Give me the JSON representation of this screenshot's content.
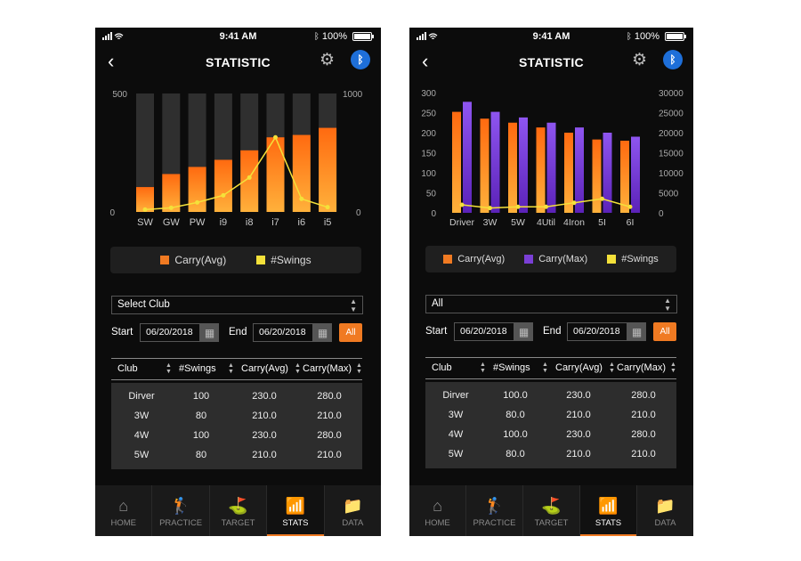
{
  "phones": [
    {
      "status": {
        "time": "9:41 AM",
        "battery": "100%"
      },
      "header": {
        "title": "STATISTIC"
      },
      "legend": [
        "Carry(Avg)",
        "#Swings"
      ],
      "select_label": "Select Club",
      "dates": {
        "start_label": "Start",
        "start": "06/20/2018",
        "end_label": "End",
        "end": "06/20/2018",
        "all": "All"
      },
      "table": {
        "headers": [
          "Club",
          "#Swings",
          "Carry(Avg)",
          "Carry(Max)"
        ],
        "rows": [
          [
            "Dirver",
            "100",
            "230.0",
            "280.0"
          ],
          [
            "3W",
            "80",
            "210.0",
            "210.0"
          ],
          [
            "4W",
            "100",
            "230.0",
            "280.0"
          ],
          [
            "5W",
            "80",
            "210.0",
            "210.0"
          ]
        ]
      },
      "tabs": [
        "HOME",
        "PRACTICE",
        "TARGET",
        "STATS",
        "DATA"
      ],
      "active_tab": "STATS"
    },
    {
      "status": {
        "time": "9:41 AM",
        "battery": "100%"
      },
      "header": {
        "title": "STATISTIC"
      },
      "legend": [
        "Carry(Avg)",
        "Carry(Max)",
        "#Swings"
      ],
      "select_label": "All",
      "dates": {
        "start_label": "Start",
        "start": "06/20/2018",
        "end_label": "End",
        "end": "06/20/2018",
        "all": "All"
      },
      "table": {
        "headers": [
          "Club",
          "#Swings",
          "Carry(Avg)",
          "Carry(Max)"
        ],
        "rows": [
          [
            "Dirver",
            "100.0",
            "230.0",
            "280.0"
          ],
          [
            "3W",
            "80.0",
            "210.0",
            "210.0"
          ],
          [
            "4W",
            "100.0",
            "230.0",
            "280.0"
          ],
          [
            "5W",
            "80.0",
            "210.0",
            "210.0"
          ]
        ]
      },
      "tabs": [
        "HOME",
        "PRACTICE",
        "TARGET",
        "STATS",
        "DATA"
      ],
      "active_tab": "STATS"
    }
  ],
  "colors": {
    "orange": "#f07a22",
    "purple": "#7a3fd6",
    "yellow": "#f4e13a",
    "accent_blue": "#1e6fd9"
  },
  "chart_data": [
    {
      "type": "bar",
      "categories": [
        "SW",
        "GW",
        "PW",
        "i9",
        "i8",
        "i7",
        "i6",
        "i5"
      ],
      "series": [
        {
          "name": "Carry(Avg)",
          "axis": "left",
          "values": [
            105,
            160,
            190,
            220,
            260,
            315,
            325,
            355
          ]
        },
        {
          "name": "#Swings",
          "type": "line",
          "axis": "right",
          "values": [
            20,
            35,
            80,
            140,
            290,
            630,
            110,
            40
          ]
        }
      ],
      "ylim_left": [
        0,
        500
      ],
      "ylim_right": [
        0,
        1000
      ],
      "yticks_left": [
        "0",
        "500"
      ],
      "yticks_right": [
        "0",
        "1000"
      ],
      "background_bars": true
    },
    {
      "type": "bar",
      "categories": [
        "Driver",
        "3W",
        "5W",
        "4Util",
        "4Iron",
        "5I",
        "6I"
      ],
      "series": [
        {
          "name": "Carry(Avg)",
          "axis": "left",
          "values": [
            252,
            235,
            225,
            213,
            200,
            183,
            180
          ]
        },
        {
          "name": "Carry(Max)",
          "axis": "left",
          "values": [
            277,
            252,
            238,
            225,
            213,
            200,
            190
          ]
        },
        {
          "name": "#Swings",
          "type": "line",
          "axis": "right",
          "values": [
            2000,
            1200,
            1500,
            1500,
            2500,
            3500,
            1500
          ]
        }
      ],
      "ylim_left": [
        0,
        300
      ],
      "ylim_right": [
        0,
        30000
      ],
      "yticks_left": [
        "0",
        "50",
        "100",
        "150",
        "200",
        "250",
        "300"
      ],
      "yticks_right": [
        "0",
        "5000",
        "10000",
        "15000",
        "20000",
        "25000",
        "30000"
      ]
    }
  ]
}
